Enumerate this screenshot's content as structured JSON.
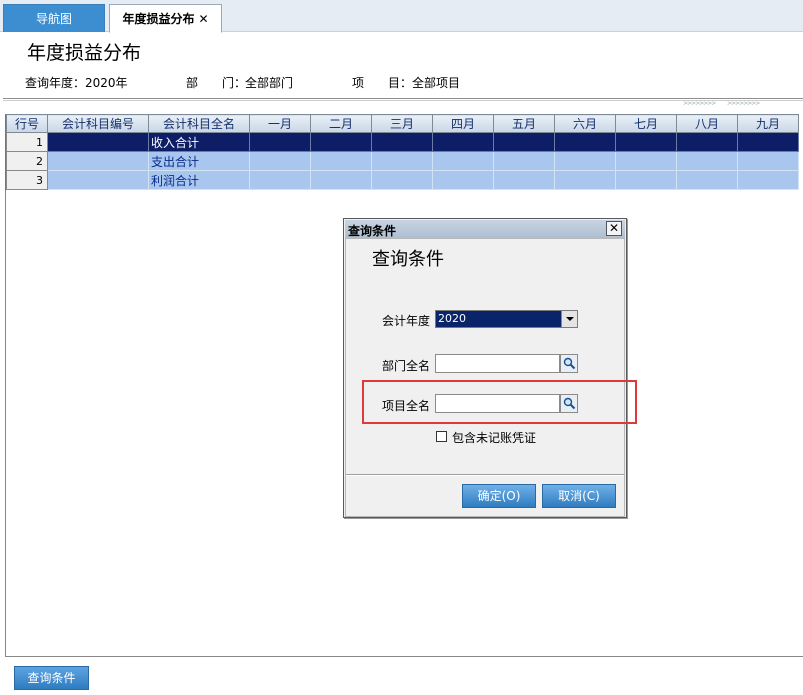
{
  "tabs": {
    "nav_label": "导航图",
    "active_label": "年度损益分布",
    "close_symbol": "✕"
  },
  "page": {
    "title": "年度损益分布",
    "filter_year": "查询年度：2020年",
    "filter_dept_label": "部　　门：",
    "filter_dept_value": "全部部门",
    "filter_proj_label": "项　　目：",
    "filter_proj_value": "全部项目"
  },
  "grid": {
    "headers": [
      "行号",
      "会计科目编号",
      "会计科目全名",
      "一月",
      "二月",
      "三月",
      "四月",
      "五月",
      "六月",
      "七月",
      "八月",
      "九月"
    ],
    "rows": [
      {
        "num": "1",
        "code": "",
        "name": "收入合计"
      },
      {
        "num": "2",
        "code": "",
        "name": "支出合计"
      },
      {
        "num": "3",
        "code": "",
        "name": "利润合计"
      }
    ],
    "selected_row": 1
  },
  "bottom": {
    "query_button": "查询条件"
  },
  "dialog": {
    "window_title": "查询条件",
    "heading": "查询条件",
    "year_label": "会计年度",
    "year_value": "2020",
    "dept_label": "部门全名",
    "proj_label": "项目全名",
    "checkbox_label": "包含未记账凭证",
    "checkbox_checked": false,
    "ok_button": "确定(O)",
    "cancel_button": "取消(C)",
    "close_symbol": "✕"
  },
  "colors": {
    "tab_blue": "#3d8ed1",
    "selected_row": "#0d1e66",
    "row_fill": "#a9c6ee",
    "highlight_red": "#e0393b"
  }
}
